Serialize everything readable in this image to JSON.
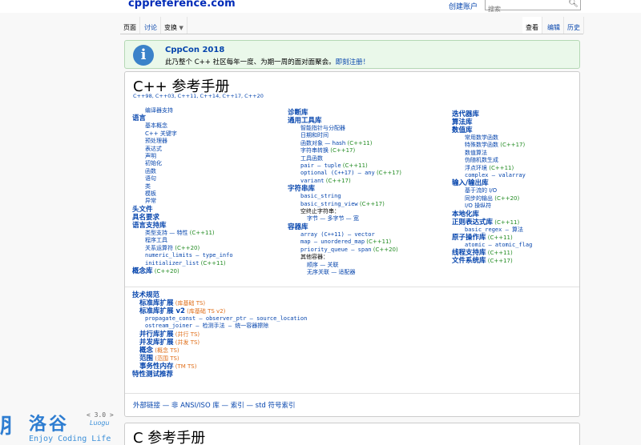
{
  "header": {
    "logo": "cppreference.com",
    "create_account": "创建账户",
    "search_placeholder": "搜索"
  },
  "tabs_left": [
    "页面",
    "讨论",
    "变换"
  ],
  "tabs_right": [
    "查看",
    "编辑",
    "历史"
  ],
  "notice": {
    "title": "CppCon 2018",
    "text": "此乃整个 C++ 社区每年一度、为期一周的面对面聚会。",
    "link": "即刻注册！"
  },
  "cpp": {
    "title": "C++ 参考手册",
    "versions": "C++98, C++03, C++11, C++14, C++17, C++20",
    "col1": [
      {
        "t": "编译器支持",
        "c": "i1"
      },
      {
        "t": "语言",
        "c": "h"
      },
      {
        "t": "基本概念",
        "c": "i1"
      },
      {
        "t": "C++ 关键字",
        "c": "i1"
      },
      {
        "t": "预处理器",
        "c": "i1"
      },
      {
        "t": "表达式",
        "c": "i1"
      },
      {
        "t": "声明",
        "c": "i1"
      },
      {
        "t": "初始化",
        "c": "i1"
      },
      {
        "t": "函数",
        "c": "i1"
      },
      {
        "t": "语句",
        "c": "i1"
      },
      {
        "t": "类",
        "c": "i1"
      },
      {
        "t": "模板",
        "c": "i1"
      },
      {
        "t": "异常",
        "c": "i1"
      },
      {
        "t": "头文件",
        "c": "h"
      },
      {
        "t": "具名要求",
        "c": "h"
      },
      {
        "t": "语言支持库",
        "c": "h"
      },
      {
        "t": "类型支持 — 特性 (C++11)",
        "c": "i1"
      },
      {
        "t": "程序工具",
        "c": "i1"
      },
      {
        "t": "关系运算符 (C++20)",
        "c": "i1"
      },
      {
        "t": "numeric_limits — type_info",
        "c": "i1 mono"
      },
      {
        "t": "initializer_list (C++11)",
        "c": "i1 mono"
      },
      {
        "t": "概念库 (C++20)",
        "c": "h"
      }
    ],
    "col2": [
      {
        "t": "诊断库",
        "c": "h"
      },
      {
        "t": "通用工具库",
        "c": "h"
      },
      {
        "t": "智能指针与分配器",
        "c": "i1"
      },
      {
        "t": "日期和时间",
        "c": "i1"
      },
      {
        "t": "函数对象 — hash (C++11)",
        "c": "i1"
      },
      {
        "t": "字符串转换 (C++17)",
        "c": "i1"
      },
      {
        "t": "工具函数",
        "c": "i1"
      },
      {
        "t": "pair — tuple (C++11)",
        "c": "i1 mono"
      },
      {
        "t": "optional (C++17) — any (C++17)",
        "c": "i1 mono"
      },
      {
        "t": "variant (C++17)",
        "c": "i1 mono"
      },
      {
        "t": "字符串库",
        "c": "h"
      },
      {
        "t": "basic_string",
        "c": "i1 mono"
      },
      {
        "t": "basic_string_view (C++17)",
        "c": "i1 mono"
      },
      {
        "t": "空终止字符串：",
        "c": "i1 dark"
      },
      {
        "t": "字节 — 多字节 — 宽",
        "c": "i2 lnk"
      },
      {
        "t": "容器库",
        "c": "h"
      },
      {
        "t": "array (C++11) — vector",
        "c": "i1 mono"
      },
      {
        "t": "map — unordered_map (C++11)",
        "c": "i1 mono"
      },
      {
        "t": "priority_queue — span (C++20)",
        "c": "i1 mono"
      },
      {
        "t": "其他容器：",
        "c": "i1 dark"
      },
      {
        "t": "顺序 — 关联",
        "c": "i2 lnk"
      },
      {
        "t": "无序关联 — 适配器",
        "c": "i2 lnk"
      }
    ],
    "col3": [
      {
        "t": "迭代器库",
        "c": "h"
      },
      {
        "t": "算法库",
        "c": "h"
      },
      {
        "t": "数值库",
        "c": "h"
      },
      {
        "t": "常用数学函数",
        "c": "i1"
      },
      {
        "t": "特殊数学函数 (C++17)",
        "c": "i1"
      },
      {
        "t": "数值算法",
        "c": "i1"
      },
      {
        "t": "伪随机数生成",
        "c": "i1"
      },
      {
        "t": "浮点环境 (C++11)",
        "c": "i1"
      },
      {
        "t": "complex — valarray",
        "c": "i1 mono"
      },
      {
        "t": "输入/输出库",
        "c": "h"
      },
      {
        "t": "基于流的 I/O",
        "c": "i1"
      },
      {
        "t": "同步的输出 (C++20)",
        "c": "i1"
      },
      {
        "t": "I/O 操纵符",
        "c": "i1"
      },
      {
        "t": "本地化库",
        "c": "h"
      },
      {
        "t": "正则表达式库 (C++11)",
        "c": "h"
      },
      {
        "t": "basic_regex — 算法",
        "c": "i1 mono"
      },
      {
        "t": "原子操作库 (C++11)",
        "c": "h"
      },
      {
        "t": "atomic — atomic_flag",
        "c": "i1 mono"
      },
      {
        "t": "线程支持库 (C++11)",
        "c": "h"
      },
      {
        "t": "文件系统库 (C++17)",
        "c": "h"
      }
    ],
    "ts": [
      {
        "t": "技术规范",
        "c": "h"
      },
      {
        "t": "标准库扩展 (库基础 TS)",
        "c": "h pad8"
      },
      {
        "t": "标准库扩展 v2 (库基础 TS v2)",
        "c": "h pad8"
      },
      {
        "t": "propagate_const — observer_ptr — source_location",
        "c": "i1 mono"
      },
      {
        "t": "ostream_joiner — 检测手法 — 统一容器擦除",
        "c": "i1 mono"
      },
      {
        "t": "并行库扩展 (并行 TS)",
        "c": "h pad8"
      },
      {
        "t": "并发库扩展 (并发 TS)",
        "c": "h pad8"
      },
      {
        "t": "概念 (概念 TS)",
        "c": "h pad8"
      },
      {
        "t": "范围 (范围 TS)",
        "c": "h pad8"
      },
      {
        "t": "事务性内存 (TM TS)",
        "c": "h pad8"
      },
      {
        "t": "特性测试推荐",
        "c": "h"
      }
    ],
    "footer": "外部链接 — 非 ANSI/ISO 库 — 索引 — std 符号索引"
  },
  "c": {
    "title": "C 参考手册"
  },
  "watermark": {
    "mark": "⺼",
    "name": "洛谷",
    "version": "< 3.0 >",
    "sub": "Luogu",
    "slogan": "Enjoy Coding Life"
  }
}
